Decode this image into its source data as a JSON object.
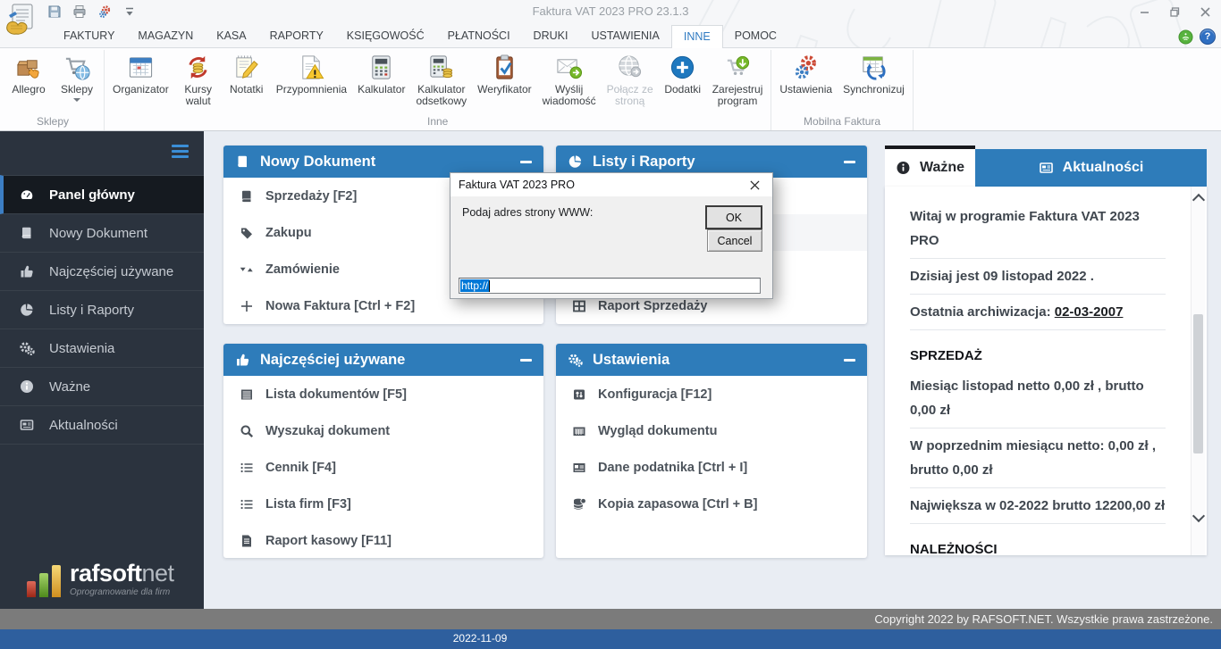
{
  "titlebar": {
    "title": "Faktura VAT 2023 PRO 23.1.3"
  },
  "header": {
    "help_glyph": "?"
  },
  "tabs": {
    "items": [
      "FAKTURY",
      "MAGAZYN",
      "KASA",
      "RAPORTY",
      "KSIĘGOWOŚĆ",
      "PŁATNOŚCI",
      "DRUKI",
      "USTAWIENIA",
      "INNE",
      "POMOC"
    ],
    "active": "INNE"
  },
  "ribbon": {
    "groups": [
      {
        "label": "Sklepy",
        "items": [
          {
            "label": "Allegro",
            "icon": "allegro-icon"
          },
          {
            "label": "Sklepy",
            "icon": "shops-icon",
            "dropdown": true
          }
        ]
      },
      {
        "label": "Inne",
        "items": [
          {
            "label": "Organizator",
            "icon": "organizer-icon"
          },
          {
            "label": "Kursy\nwalut",
            "icon": "currency-rates-icon"
          },
          {
            "label": "Notatki",
            "icon": "notes-icon"
          },
          {
            "label": "Przypomnienia",
            "icon": "reminders-icon"
          },
          {
            "label": "Kalkulator",
            "icon": "calculator-icon"
          },
          {
            "label": "Kalkulator\nodsetkowy",
            "icon": "interest-calculator-icon"
          },
          {
            "label": "Weryfikator",
            "icon": "verifier-icon"
          },
          {
            "label": "Wyślij\nwiadomość",
            "icon": "send-message-icon"
          },
          {
            "label": "Połącz ze\nstroną",
            "icon": "connect-website-icon",
            "disabled": true
          },
          {
            "label": "Dodatki",
            "icon": "addons-icon"
          },
          {
            "label": "Zarejestruj\nprogram",
            "icon": "register-icon"
          }
        ]
      },
      {
        "label": "Mobilna Faktura",
        "items": [
          {
            "label": "Ustawienia",
            "icon": "mobile-settings-icon"
          },
          {
            "label": "Synchronizuj",
            "icon": "sync-icon"
          }
        ]
      }
    ]
  },
  "sidebar": {
    "items": [
      {
        "label": "Panel główny",
        "icon": "dashboard-icon",
        "active": true
      },
      {
        "label": "Nowy Dokument",
        "icon": "book-icon"
      },
      {
        "label": "Najczęściej używane",
        "icon": "thumbs-up-icon"
      },
      {
        "label": "Listy i Raporty",
        "icon": "pie-chart-icon"
      },
      {
        "label": "Ustawienia",
        "icon": "gears-icon"
      },
      {
        "label": "Ważne",
        "icon": "info-icon"
      },
      {
        "label": "Aktualności",
        "icon": "news-icon"
      }
    ],
    "logo": {
      "brand_bold": "rafsoft",
      "brand_light": "net",
      "tagline": "Oprogramowanie dla firm"
    }
  },
  "panels": [
    {
      "title": "Nowy Dokument",
      "icon": "book-icon",
      "items": [
        {
          "label": "Sprzedaży [F2]",
          "icon": "book-icon"
        },
        {
          "label": "Zakupu",
          "icon": "tag-icon"
        },
        {
          "label": "Zamówienie",
          "icon": "sort-icon"
        },
        {
          "label": "Nowa Faktura [Ctrl + F2]",
          "icon": "plus-icon"
        }
      ]
    },
    {
      "title": "Listy i Raporty",
      "icon": "pie-chart-icon",
      "items": [
        {
          "label": "",
          "icon": ""
        },
        {
          "label": "",
          "icon": "",
          "shaded": true
        },
        {
          "label": "",
          "icon": ""
        },
        {
          "label": "Raport Sprzedaży",
          "icon": "grid-icon"
        }
      ]
    },
    {
      "title": "Najczęściej używane",
      "icon": "thumbs-up-icon",
      "items": [
        {
          "label": "Lista dokumentów [F5]",
          "icon": "table-icon"
        },
        {
          "label": "Wyszukaj dokument",
          "icon": "search-icon"
        },
        {
          "label": "Cennik [F4]",
          "icon": "list-icon"
        },
        {
          "label": "Lista firm [F3]",
          "icon": "list-icon"
        },
        {
          "label": "Raport kasowy [F11]",
          "icon": "report-icon"
        }
      ]
    },
    {
      "title": "Ustawienia",
      "icon": "gears-icon",
      "items": [
        {
          "label": "Konfiguracja [F12]",
          "icon": "config-icon"
        },
        {
          "label": "Wygląd dokumentu",
          "icon": "layout-icon"
        },
        {
          "label": "Dane podatnika [Ctrl + I]",
          "icon": "id-card-icon"
        },
        {
          "label": "Kopia zapasowa [Ctrl + B]",
          "icon": "backup-icon"
        }
      ]
    }
  ],
  "info_panel": {
    "tabs": [
      {
        "label": "Ważne",
        "icon": "info-icon",
        "active": true
      },
      {
        "label": "Aktualności",
        "icon": "news-icon",
        "active": false
      }
    ],
    "entries": [
      {
        "type": "text",
        "text": "Witaj w programie Faktura VAT 2023 PRO"
      },
      {
        "type": "text",
        "text": "Dzisiaj jest 09 listopad 2022 ."
      },
      {
        "type": "link_line",
        "text": "Ostatnia archiwizacja: ",
        "link": "02-03-2007"
      },
      {
        "type": "heading",
        "text": "SPRZEDAŻ"
      },
      {
        "type": "text",
        "text": "Miesiąc listopad netto 0,00 zł , brutto 0,00 zł"
      },
      {
        "type": "text",
        "text": "W poprzednim miesiącu netto: 0,00 zł , brutto 0,00 zł"
      },
      {
        "type": "text",
        "text": "Największa w 02-2022 brutto 12200,00 zł"
      },
      {
        "type": "heading",
        "text": "NALEŻNOŚCI"
      }
    ]
  },
  "dialog": {
    "title": "Faktura VAT 2023 PRO",
    "message": "Podaj adres strony WWW:",
    "input_value": "http://",
    "ok_label": "OK",
    "cancel_label": "Cancel"
  },
  "footer": {
    "copyright": "Copyright 2022 by RAFSOFT.NET. Wszystkie prawa zastrzeżone.",
    "status_date": "2022-11-09"
  },
  "colors": {
    "accent_blue": "#2e7cba",
    "sidebar_bg": "#2b333e",
    "selection_blue": "#0078d7",
    "footer_gray": "#7b7b7b",
    "footer_blue": "#2e5f9e"
  }
}
